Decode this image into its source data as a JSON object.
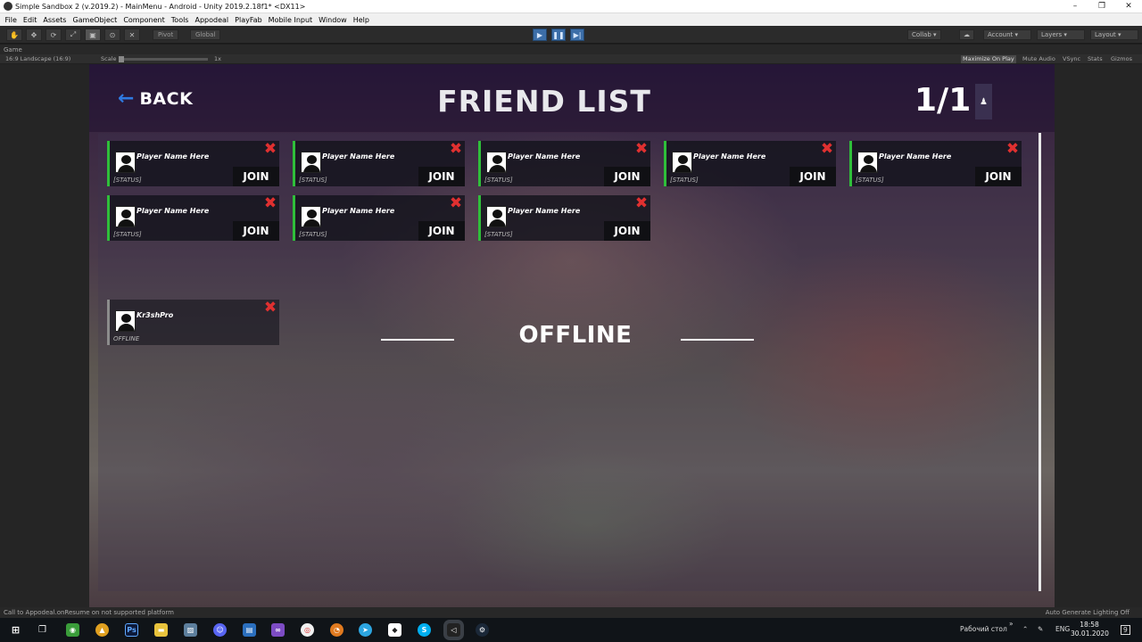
{
  "window": {
    "title": "Simple Sandbox 2 (v.2019.2) - MainMenu - Android - Unity 2019.2.18f1* <DX11>",
    "controls": [
      "–",
      "❐",
      "✕"
    ]
  },
  "menu": [
    "File",
    "Edit",
    "Assets",
    "GameObject",
    "Component",
    "Tools",
    "Appodeal",
    "PlayFab",
    "Mobile Input",
    "Window",
    "Help"
  ],
  "toolbar": {
    "pivot": "Pivot",
    "global": "Global",
    "collab": "Collab",
    "account": "Account",
    "layers": "Layers",
    "layout": "Layout"
  },
  "game_view": {
    "tab": "Game",
    "aspect": "16:9 Landscape (16:9)",
    "scale_label": "Scale",
    "scale_value": "1x",
    "options": [
      "Maximize On Play",
      "Mute Audio",
      "VSync",
      "Stats",
      "Gizmos"
    ]
  },
  "screen": {
    "back_label": "BACK",
    "title": "FRIEND LIST",
    "page": "1/1",
    "offline_heading": "OFFLINE"
  },
  "online_friends": [
    {
      "name": "Player Name Here",
      "status": "[STATUS]",
      "join": "JOIN"
    },
    {
      "name": "Player Name Here",
      "status": "[STATUS]",
      "join": "JOIN"
    },
    {
      "name": "Player Name Here",
      "status": "[STATUS]",
      "join": "JOIN"
    },
    {
      "name": "Player Name Here",
      "status": "[STATUS]",
      "join": "JOIN"
    },
    {
      "name": "Player Name Here",
      "status": "[STATUS]",
      "join": "JOIN"
    },
    {
      "name": "Player Name Here",
      "status": "[STATUS]",
      "join": "JOIN"
    },
    {
      "name": "Player Name Here",
      "status": "[STATUS]",
      "join": "JOIN"
    },
    {
      "name": "Player Name Here",
      "status": "[STATUS]",
      "join": "JOIN"
    }
  ],
  "offline_friends": [
    {
      "name": "Kr3shPro",
      "status": "OFFLINE"
    }
  ],
  "status_bar": {
    "message": "Call to Appodeal.onResume on not supported platform",
    "right": "Auto Generate Lighting Off"
  },
  "taskbar": {
    "desktop": "Рабочий стол",
    "lang": "ENG",
    "time": "18:58",
    "date": "30.01.2020",
    "notifications": "9"
  },
  "colors": {
    "online_accent": "#2fbf3a",
    "remove": "#e03030",
    "back_arrow": "#2f7ae0"
  }
}
